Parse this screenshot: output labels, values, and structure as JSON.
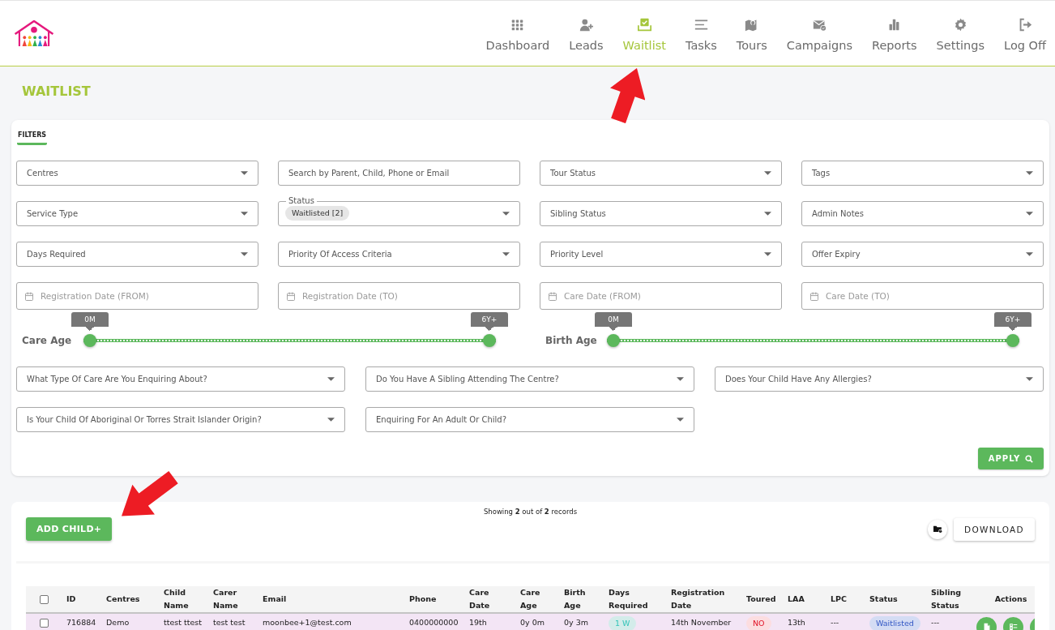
{
  "header": {
    "nav": [
      {
        "label": "Dashboard",
        "selected": false
      },
      {
        "label": "Leads",
        "selected": false
      },
      {
        "label": "Waitlist",
        "selected": true
      },
      {
        "label": "Tasks",
        "selected": false
      },
      {
        "label": "Tours",
        "selected": false
      },
      {
        "label": "Campaigns",
        "selected": false
      },
      {
        "label": "Reports",
        "selected": false
      },
      {
        "label": "Settings",
        "selected": false
      },
      {
        "label": "Log Off",
        "selected": false
      }
    ]
  },
  "page_title": "WAITLIST",
  "filters": {
    "tab": {
      "label": "FILTERS",
      "selected": true
    },
    "fields": [
      {
        "kind": "select",
        "label": "Centres"
      },
      {
        "kind": "search",
        "placeholder": "Search by Parent, Child, Phone or Email"
      },
      {
        "kind": "select",
        "label": "Tour Status"
      },
      {
        "kind": "select",
        "label": "Tags"
      },
      {
        "kind": "select",
        "label": "Service Type"
      },
      {
        "kind": "select",
        "label": "Status",
        "chips": [
          "Waitlisted [2]"
        ]
      },
      {
        "kind": "select",
        "label": "Sibling Status"
      },
      {
        "kind": "select",
        "label": "Admin Notes"
      },
      {
        "kind": "select",
        "label": "Days Required"
      },
      {
        "kind": "select",
        "label": "Priority Of Access Criteria"
      },
      {
        "kind": "select",
        "label": "Priority Level"
      },
      {
        "kind": "select",
        "label": "Offer Expiry"
      },
      {
        "kind": "date",
        "placeholder": "Registration Date (FROM)"
      },
      {
        "kind": "date",
        "placeholder": "Registration Date (TO)"
      },
      {
        "kind": "date",
        "placeholder": "Care Date (FROM)"
      },
      {
        "kind": "date",
        "placeholder": "Care Date (TO)"
      }
    ],
    "sliders": [
      {
        "label": "Care Age",
        "min": "0M",
        "max": "6Y+",
        "level": 1
      },
      {
        "label": "Birth Age",
        "min": "0M",
        "max": "6Y+",
        "level": 1
      }
    ],
    "questions": [
      {
        "label": "What Type Of Care Are You Enquiring About?"
      },
      {
        "label": "Do You Have A Sibling Attending The Centre?"
      },
      {
        "label": "Does Your Child Have Any Allergies?"
      },
      {
        "label": "Is Your Child Of Aboriginal Or Torres Strait Islander Origin?"
      },
      {
        "label": "Enquiring For An Adult Or Child?"
      }
    ],
    "apply_button": "APPLY"
  },
  "records": {
    "add_button": "ADD CHILD+",
    "summary": "Showing **2** out of **2** records",
    "download_button": "DOWNLOAD",
    "table": {
      "all_checked": false,
      "columns": [
        "ID",
        "Centres",
        "Child Name",
        "Carer Name",
        "Email",
        "Phone",
        "Care Date",
        "Care Age",
        "Birth Age",
        "Days Required",
        "Registration Date",
        "Toured",
        "LAA",
        "LPC",
        "Status",
        "Sibling Status",
        "Actions"
      ],
      "rows": [
        {
          "checked": false,
          "cells": [
            {
              "kind": "text",
              "text": "716884"
            },
            {
              "kind": "text",
              "text": "Demo"
            },
            {
              "kind": "text",
              "text": "ttest ttest"
            },
            {
              "kind": "text",
              "text": "test test"
            },
            {
              "kind": "text",
              "text": "moonbee+1@test.com"
            },
            {
              "kind": "text",
              "text": "0400000000"
            },
            {
              "kind": "text",
              "text": "19th"
            },
            {
              "kind": "text",
              "text": "0y 0m"
            },
            {
              "kind": "text",
              "text": "0y 3m"
            },
            {
              "kind": "badge",
              "text": "1 W",
              "color": "#d3ecea"
            },
            {
              "kind": "text",
              "text": "14th November"
            },
            {
              "kind": "badge",
              "text": "NO",
              "color": "#fcdde0"
            },
            {
              "kind": "text",
              "text": "13th"
            },
            {
              "kind": "text",
              "text": "---"
            },
            {
              "kind": "badge",
              "text": "Waitlisted",
              "color": "#d4dcf4"
            },
            {
              "kind": "text",
              "text": "---"
            }
          ]
        }
      ]
    }
  }
}
